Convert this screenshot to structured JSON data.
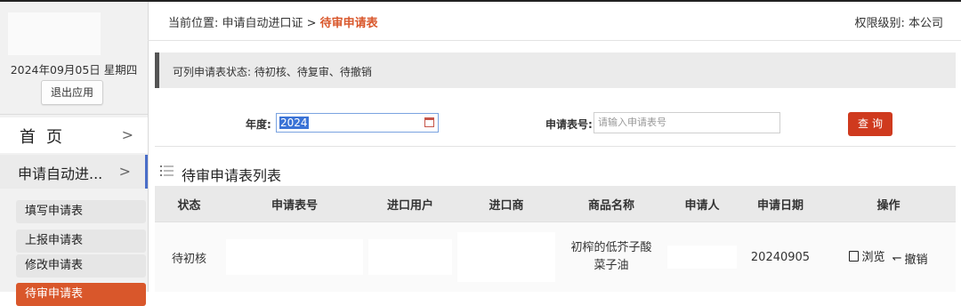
{
  "sidebar": {
    "date": "2024年09月05日 星期四",
    "exit_label": "退出应用",
    "home_label": "首页",
    "home_chevron": ">",
    "apply_label": "申请自动进...",
    "apply_chevron": ">",
    "sub_items": [
      {
        "label": "填写申请表"
      },
      {
        "label": "上报申请表"
      },
      {
        "label": "修改申请表"
      },
      {
        "label": "待审申请表"
      }
    ]
  },
  "header": {
    "breadcrumb_prefix": "当前位置: 申请自动进口证 > ",
    "breadcrumb_current": "待审申请表",
    "permission": "权限级别: 本公司"
  },
  "status_bar": {
    "text": "可列申请表状态: 待初核、待复审、待撤销"
  },
  "search": {
    "year_label": "年度:",
    "year_value": "2024",
    "app_no_label": "申请表号:",
    "app_no_placeholder": "请输入申请表号",
    "query_label": "查询"
  },
  "list": {
    "title": "待审申请表列表",
    "columns": [
      "状态",
      "申请表号",
      "进口用户",
      "进口商",
      "商品名称",
      "申请人",
      "申请日期",
      "操作"
    ],
    "rows": [
      {
        "status": "待初核",
        "app_no": "",
        "import_user": "",
        "importer": "",
        "product_name": "初榨的低芥子酸菜子油",
        "applicant": "",
        "apply_date": "20240905",
        "action_browse": "浏览",
        "action_undo": "撤销"
      }
    ]
  },
  "colors": {
    "accent": "#d9572b",
    "query_button": "#cf3a1e",
    "nav_active_border": "#4a6ec8"
  },
  "icons": [
    "calendar-icon",
    "list-icon",
    "browse-icon",
    "undo-icon",
    "chevron-right-icon"
  ]
}
